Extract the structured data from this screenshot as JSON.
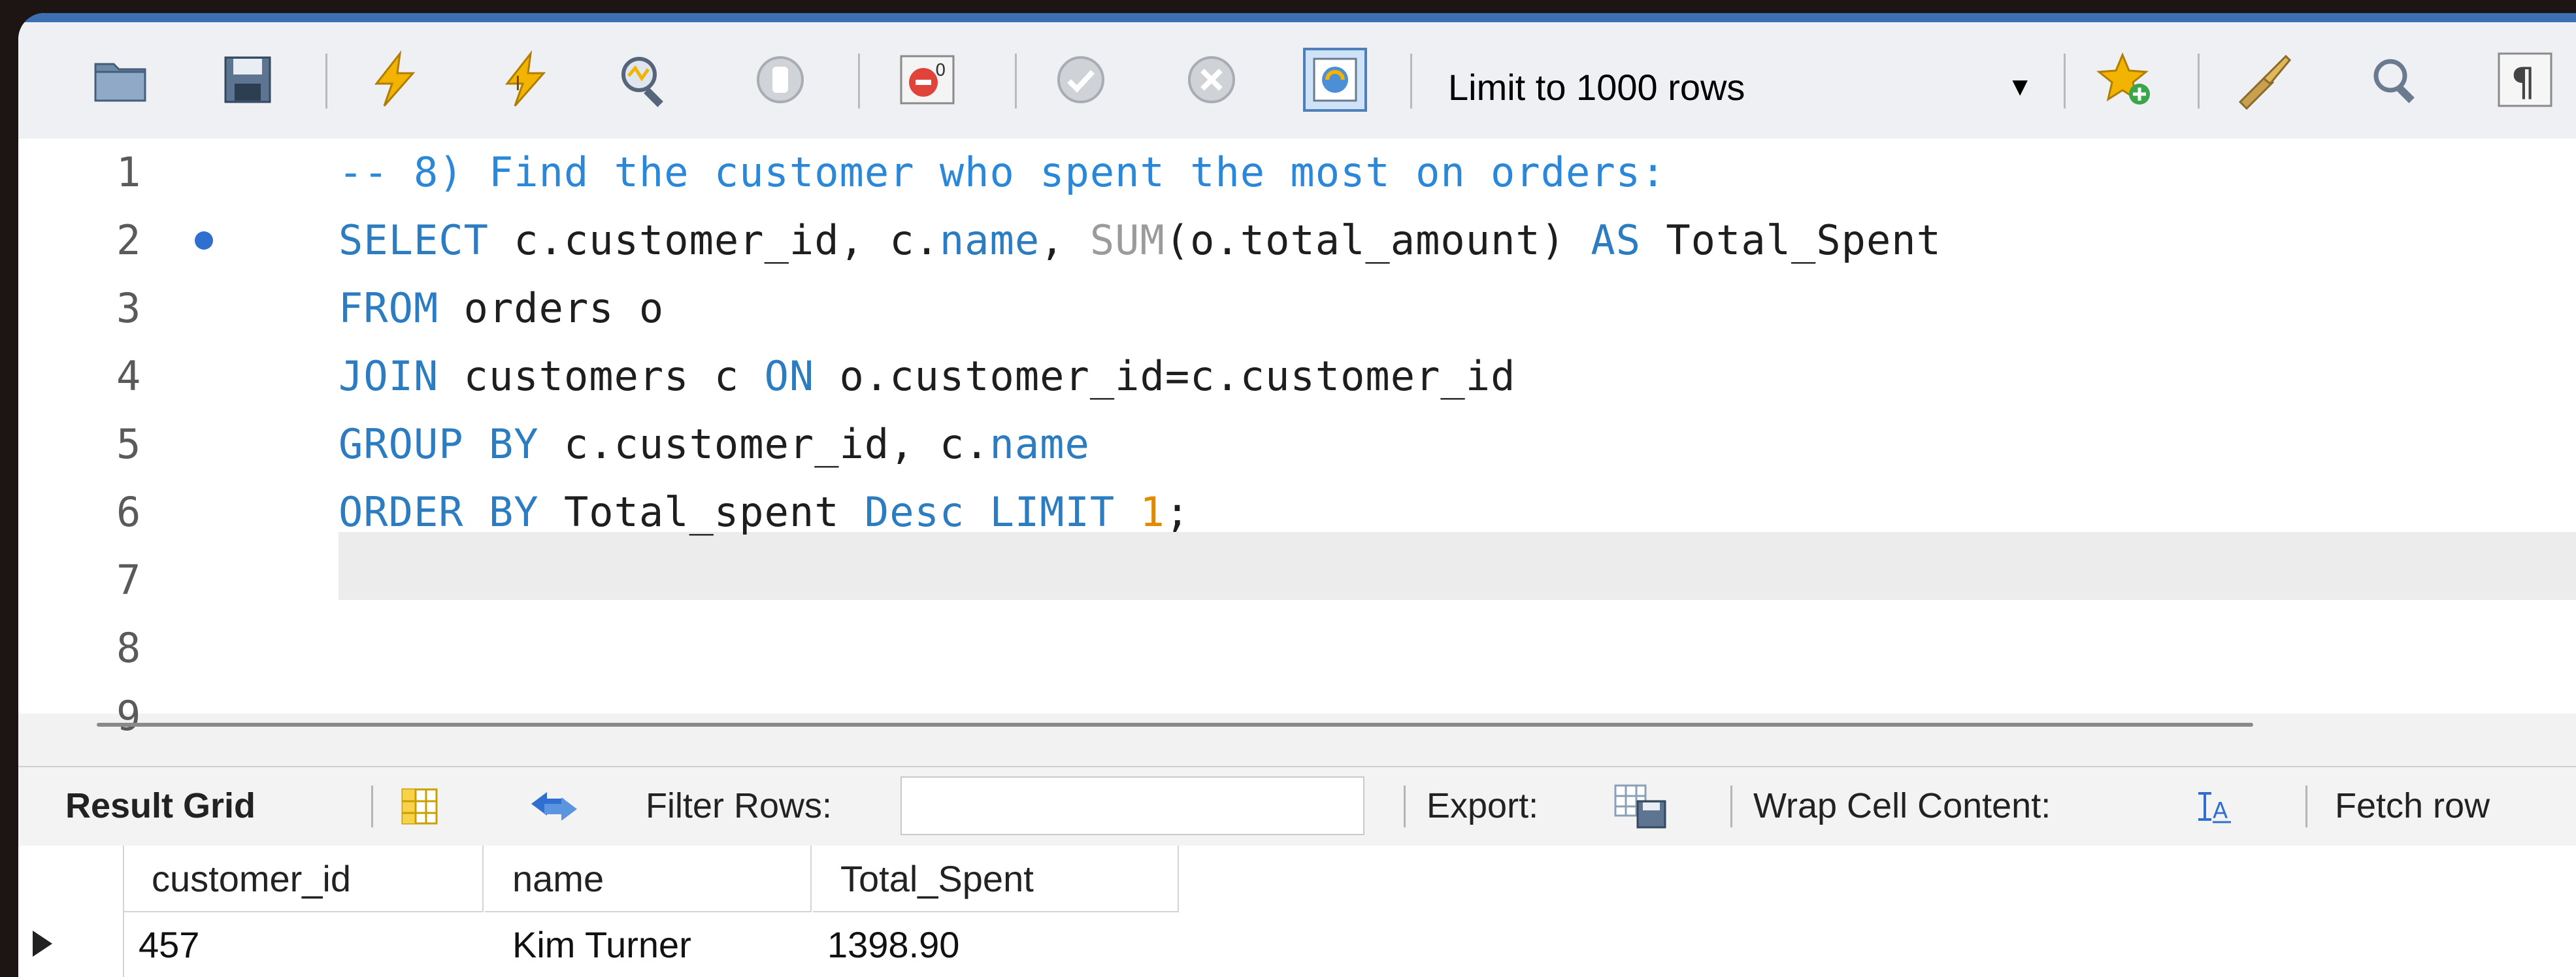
{
  "toolbar": {
    "limit_label": "Limit to 1000 rows",
    "colors": {
      "accent": "#3d6fb4",
      "lightning": "#f2b400",
      "stop": "#e0433a"
    },
    "icons": [
      "open-folder-icon",
      "save-icon",
      "execute-icon",
      "execute-current-icon",
      "explain-icon",
      "stop-icon",
      "toggle-errors-icon",
      "commit-icon",
      "rollback-icon",
      "autocommit-icon",
      "limit-dropdown",
      "add-snippet-icon",
      "beautify-icon",
      "find-icon",
      "invisible-chars-icon"
    ]
  },
  "editor": {
    "lines": [
      {
        "num": "1",
        "tokens": [
          {
            "t": "-- 8) Find the customer who spent the most on orders:",
            "c": "cm"
          }
        ]
      },
      {
        "num": "2",
        "tokens": [
          {
            "t": "SELECT",
            "c": "kw"
          },
          {
            "t": " c.customer_id, c.",
            "c": ""
          },
          {
            "t": "name",
            "c": "id"
          },
          {
            "t": ", ",
            "c": ""
          },
          {
            "t": "SUM",
            "c": "fn"
          },
          {
            "t": "(o.total_amount) ",
            "c": ""
          },
          {
            "t": "AS",
            "c": "kw"
          },
          {
            "t": " Total_Spent",
            "c": ""
          }
        ]
      },
      {
        "num": "3",
        "tokens": [
          {
            "t": "FROM",
            "c": "kw"
          },
          {
            "t": " orders o",
            "c": ""
          }
        ]
      },
      {
        "num": "4",
        "tokens": [
          {
            "t": "JOIN",
            "c": "kw"
          },
          {
            "t": " customers c ",
            "c": ""
          },
          {
            "t": "ON",
            "c": "kw"
          },
          {
            "t": " o.customer_id=c.customer_id",
            "c": ""
          }
        ]
      },
      {
        "num": "5",
        "tokens": [
          {
            "t": "GROUP BY",
            "c": "kw"
          },
          {
            "t": " c.customer_id, c.",
            "c": ""
          },
          {
            "t": "name",
            "c": "id"
          }
        ]
      },
      {
        "num": "6",
        "tokens": [
          {
            "t": "ORDER BY",
            "c": "kw"
          },
          {
            "t": " Total_spent ",
            "c": ""
          },
          {
            "t": "Desc",
            "c": "kw"
          },
          {
            "t": " ",
            "c": ""
          },
          {
            "t": "LIMIT",
            "c": "kw"
          },
          {
            "t": " ",
            "c": ""
          },
          {
            "t": "1",
            "c": "num"
          },
          {
            "t": ";",
            "c": ""
          }
        ]
      },
      {
        "num": "7",
        "tokens": []
      },
      {
        "num": "8",
        "tokens": []
      },
      {
        "num": "9",
        "tokens": []
      }
    ]
  },
  "result_toolbar": {
    "result_grid_label": "Result Grid",
    "filter_label": "Filter Rows:",
    "filter_value": "",
    "export_label": "Export:",
    "wrap_label": "Wrap Cell Content:",
    "fetch_label": "Fetch row"
  },
  "grid": {
    "columns": [
      "customer_id",
      "name",
      "Total_Spent"
    ],
    "rows": [
      [
        "457",
        "Kim Turner",
        "1398.90"
      ]
    ]
  }
}
